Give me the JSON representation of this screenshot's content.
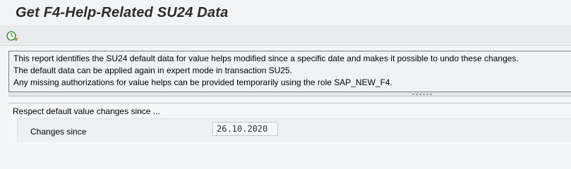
{
  "header": {
    "title": "Get F4-Help-Related SU24 Data"
  },
  "toolbar": {
    "execute_icon": "execute-clock-icon"
  },
  "info": {
    "lines": [
      "This report identifies the SU24 default data for value helps modified since a specific date and makes it possible to undo these changes.",
      "The default data can be applied again in expert mode in transaction SU25.",
      "Any missing authorizations for value helps can be provided temporarily using the role SAP_NEW_F4."
    ]
  },
  "selection": {
    "frame_title": "Respect default value changes since ...",
    "changes_since_label": "Changes since",
    "changes_since_value": "26.10.2020"
  },
  "colors": {
    "info_border": "#6f7f8c",
    "execute_icon_green": "#3a9a3a"
  }
}
